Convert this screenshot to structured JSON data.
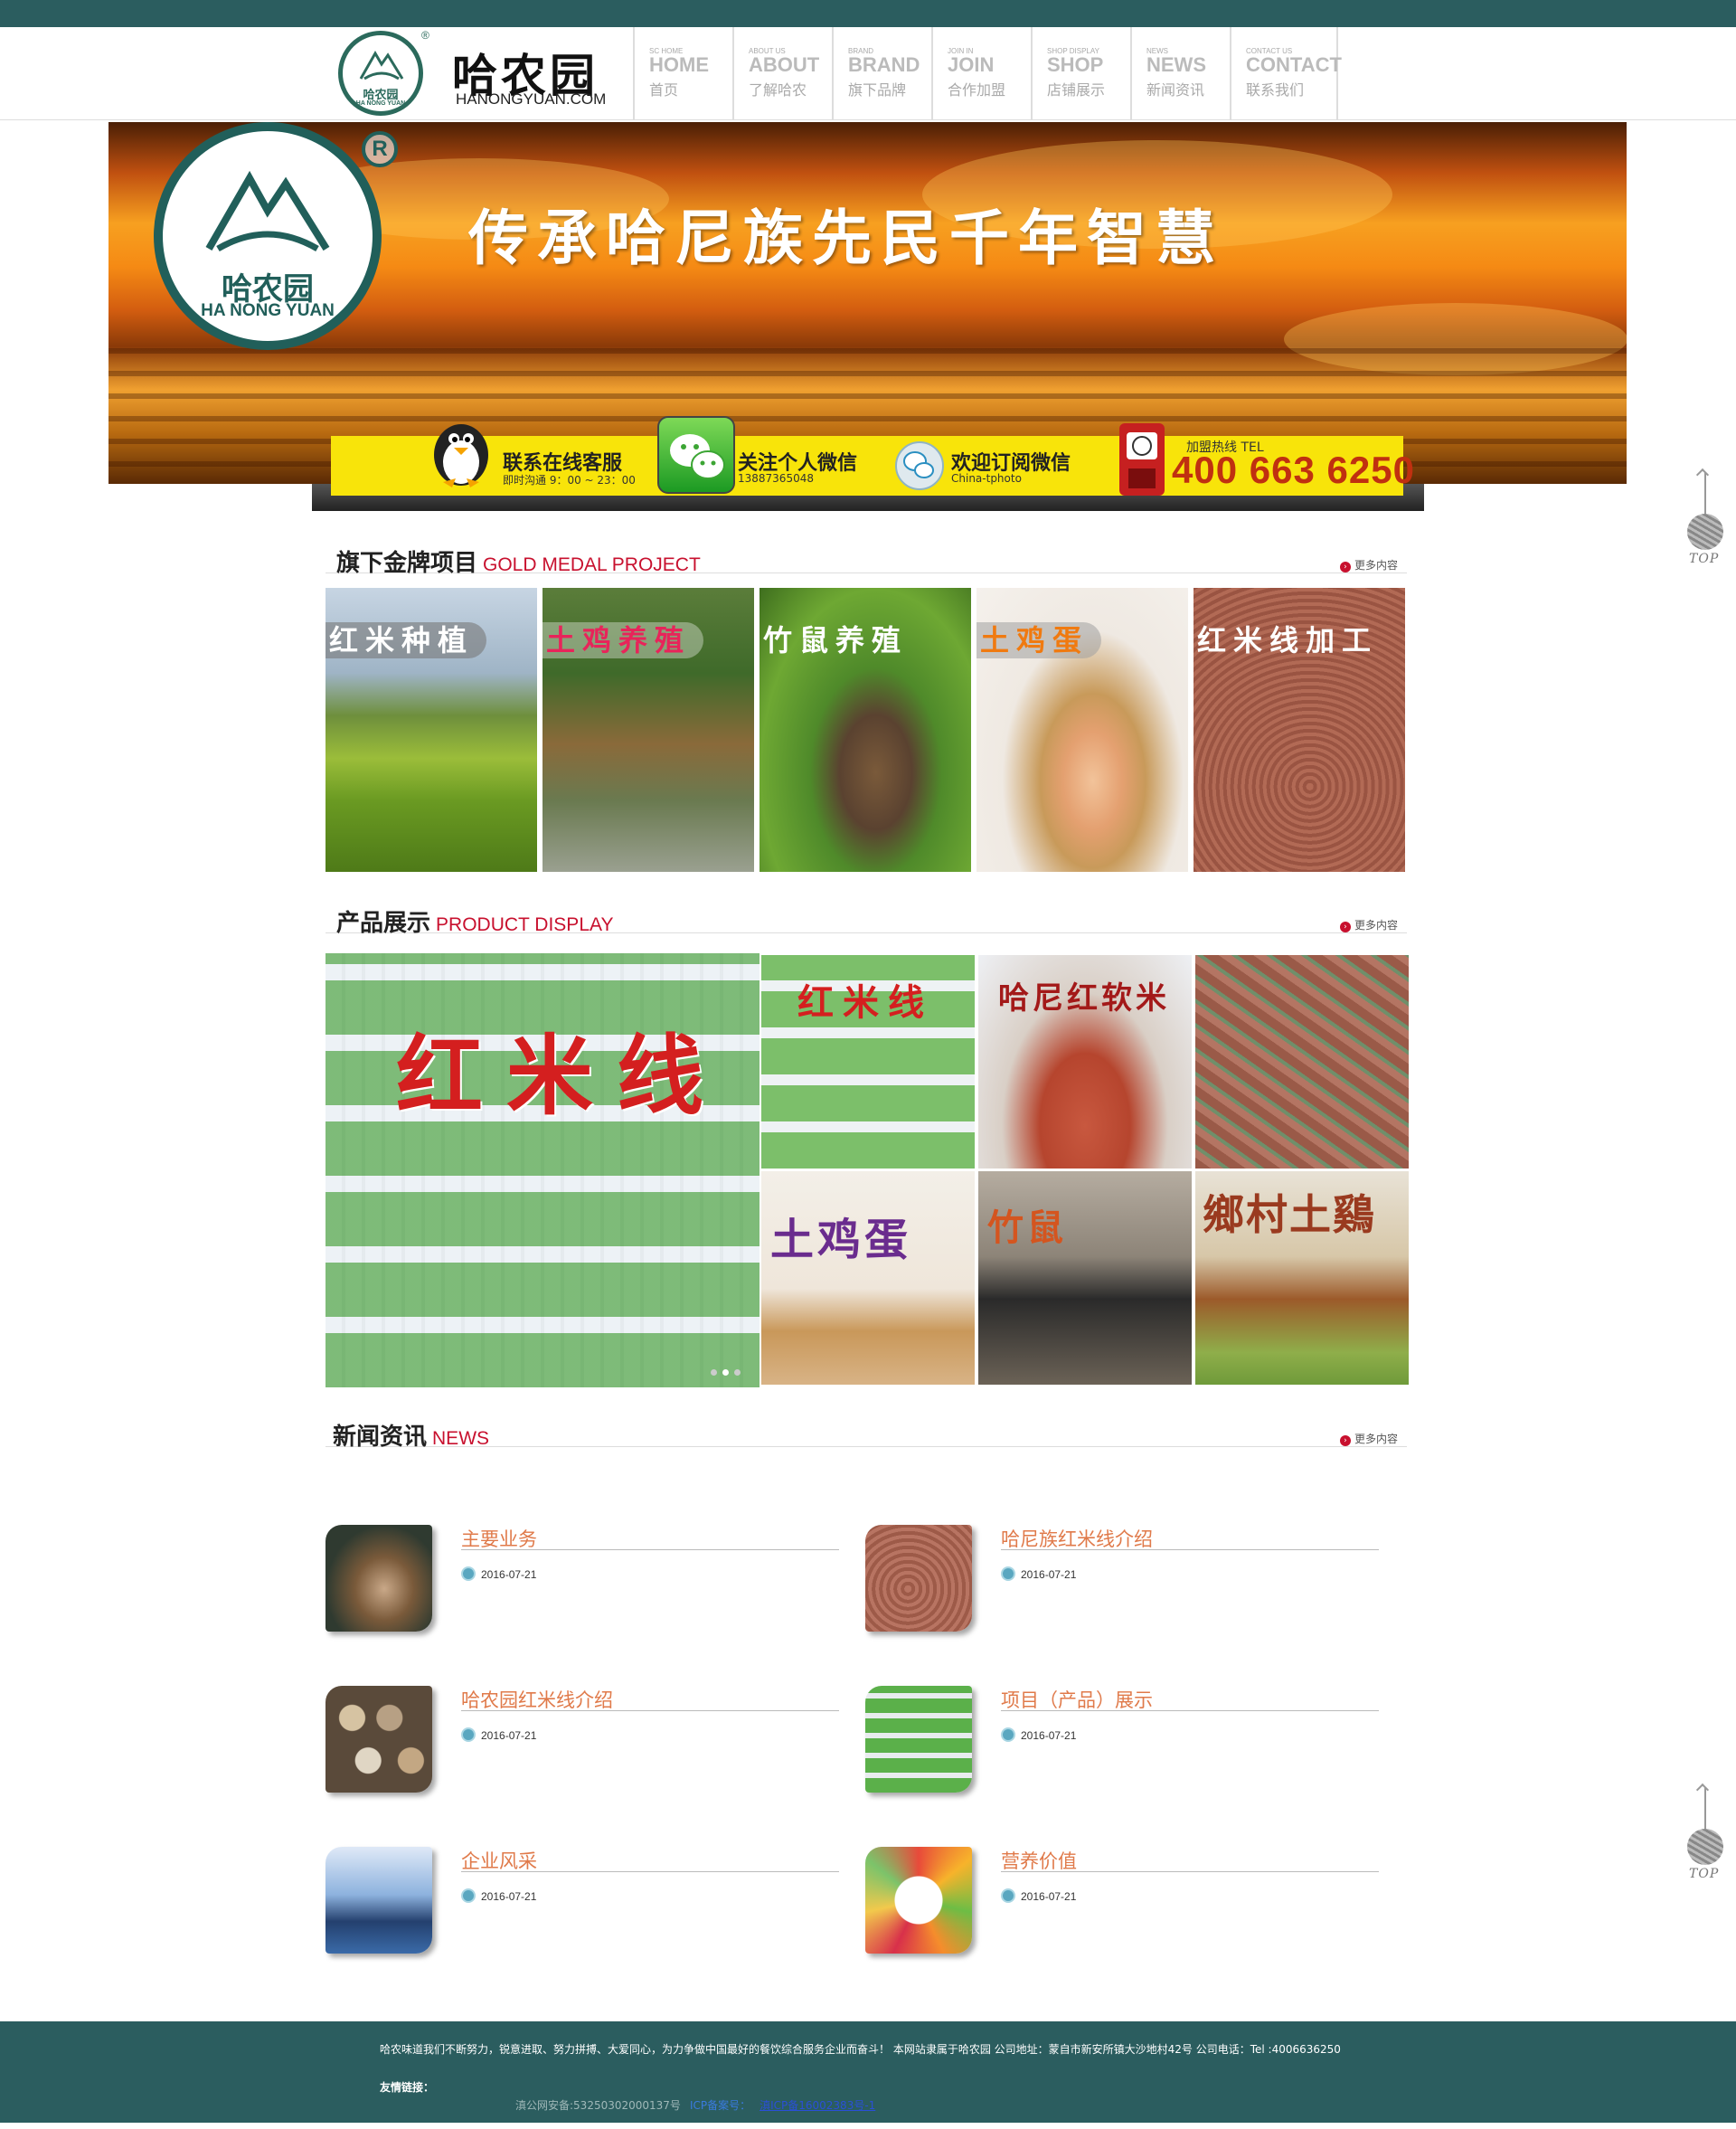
{
  "header": {
    "logo_cn": "哈农园",
    "logo_en": "HA NONG YUAN",
    "logo_mark": "®",
    "brand_cn": "哈农园",
    "brand_url": "HANONGYUAN.COM",
    "nav": [
      {
        "sm": "SC HOME",
        "big": "HOME",
        "cn": "首页"
      },
      {
        "sm": "ABOUT US",
        "big": "ABOUT",
        "cn": "了解哈农"
      },
      {
        "sm": "BRAND",
        "big": "BRAND",
        "cn": "旗下品牌"
      },
      {
        "sm": "JOIN IN",
        "big": "JOIN",
        "cn": "合作加盟"
      },
      {
        "sm": "SHOP DISPLAY",
        "big": "SHOP",
        "cn": "店铺展示"
      },
      {
        "sm": "NEWS",
        "big": "NEWS",
        "cn": "新闻资讯"
      },
      {
        "sm": "CONTACT US",
        "big": "CONTACT",
        "cn": "联系我们"
      }
    ]
  },
  "banner": {
    "logo_cn": "哈农园",
    "logo_en": "HA NONG YUAN",
    "logo_mark": "R",
    "slogan": "传承哈尼族先民千年智慧",
    "contact": {
      "service_title": "联系在线客服",
      "service_sub": "即时沟通 9：00 ~ 23：00",
      "wechat_title": "关注个人微信",
      "wechat_sub": "13887365048",
      "subscribe_title": "欢迎订阅微信",
      "subscribe_sub": "China-tphoto",
      "hotline_label": "加盟热线 TEL",
      "hotline": "400 663 6250"
    }
  },
  "sections": {
    "gold": {
      "cn": "旗下金牌项目",
      "en": "GOLD MEDAL PROJECT",
      "more": "更多内容"
    },
    "product": {
      "cn": "产品展示",
      "en": "PRODUCT DISPLAY",
      "more": "更多内容"
    },
    "news": {
      "cn": "新闻资讯",
      "en": "NEWS",
      "more": "更多内容"
    }
  },
  "projects": [
    {
      "label": "红米种植",
      "color": "#ffffff"
    },
    {
      "label": "土鸡养殖",
      "color": "#e8245a"
    },
    {
      "label": "竹鼠养殖",
      "color": "#ffffff"
    },
    {
      "label": "土鸡蛋",
      "color": "#f07a10"
    },
    {
      "label": "红米线加工",
      "color": "#ffffff"
    }
  ],
  "products": {
    "main_label": "红米线",
    "small_label_1": "红米线",
    "small_label_2": "哈尼红软米",
    "small_label_3": "土鸡蛋",
    "small_label_4": "竹鼠",
    "small_label_5": "鄉村土鷄"
  },
  "news": [
    {
      "title": "主要业务",
      "date": "2016-07-21"
    },
    {
      "title": "哈尼族红米线介绍",
      "date": "2016-07-21"
    },
    {
      "title": "哈农园红米线介绍",
      "date": "2016-07-21"
    },
    {
      "title": "项目（产品）展示",
      "date": "2016-07-21"
    },
    {
      "title": "企业风采",
      "date": "2016-07-21"
    },
    {
      "title": "营养价值",
      "date": "2016-07-21"
    }
  ],
  "top_button": "TOP",
  "footer": {
    "about": "哈农味道我们不断努力，锐意进取、努力拼搏、大爱同心，为力争做中国最好的餐饮综合服务企业而奋斗！  本网站隶属于哈农园 公司地址：蒙自市新安所镇大沙地村42号 公司电话：Tel :4006636250",
    "links_label": "友情链接：",
    "police": "滇公网安备:53250302000137号",
    "icp1": "ICP备案号：",
    "icp2": "滇ICP备16002383号-1"
  },
  "colors": {
    "brand": "#2b5d5f",
    "accent": "#c8102e",
    "news_title": "#e07a4a"
  }
}
